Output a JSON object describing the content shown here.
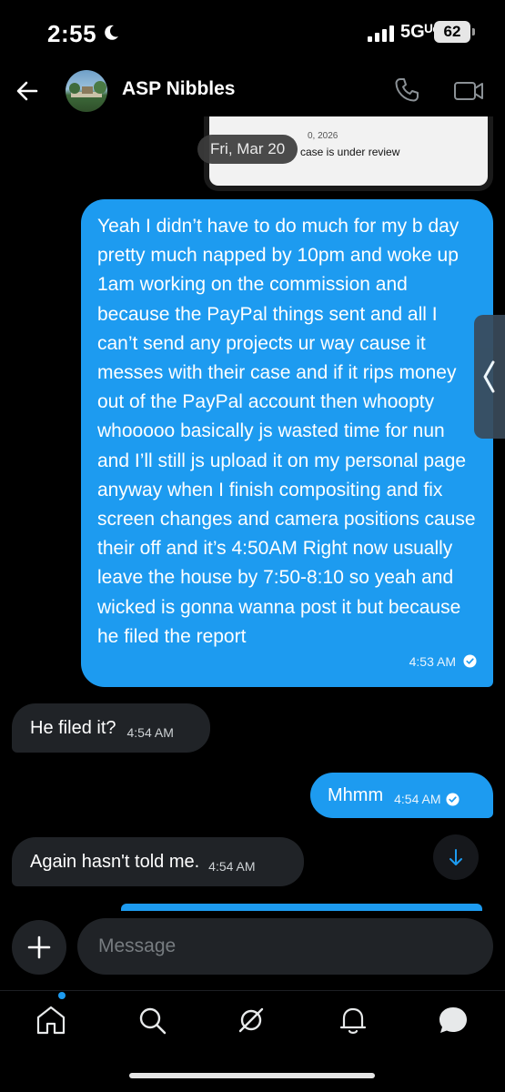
{
  "status_bar": {
    "time": "2:55",
    "network": "5Gᵁᶜ",
    "battery": "62"
  },
  "header": {
    "contact_name": "ASP Nibbles"
  },
  "attachment": {
    "date_fragment": "0, 2026",
    "text_fragment": "case is under review"
  },
  "date_divider": "Fri, Mar 20",
  "messages": [
    {
      "direction": "outgoing",
      "text": "Yeah I didn’t have to do much for my b day pretty much napped by 10pm and woke up 1am working on the commission and because the PayPal things sent and all I can’t send any projects ur way cause it messes with their case and if it rips money out of the PayPal account then whoopty whooooo basically js wasted time for nun and I’ll still js upload it on my personal page anyway when I finish compositing and fix screen changes and camera positions cause their off and it’s 4:50AM Right now usually leave the house by 7:50-8:10 so yeah and wicked is gonna wanna post it but because he filed the report",
      "time": "4:53 AM"
    },
    {
      "direction": "incoming",
      "text": "He filed it?",
      "time": "4:54 AM"
    },
    {
      "direction": "outgoing",
      "text": "Mhmm",
      "time": "4:54 AM"
    },
    {
      "direction": "incoming",
      "text": "Again hasn't told me.",
      "time": "4:54 AM"
    }
  ],
  "composer": {
    "placeholder": "Message"
  },
  "colors": {
    "accent": "#1d9bf0",
    "incoming_bubble": "#202327",
    "background": "#000000"
  },
  "icons": {
    "status": [
      "moon-icon",
      "signal-icon"
    ],
    "header": [
      "back-arrow-icon",
      "phone-icon",
      "video-icon"
    ],
    "nav": [
      "home-icon",
      "search-icon",
      "grok-icon",
      "bell-icon",
      "messages-icon"
    ]
  }
}
